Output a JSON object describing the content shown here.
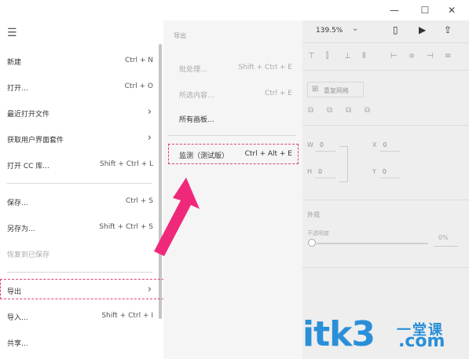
{
  "window": {
    "minimize": "—",
    "maximize": "☐",
    "close": "✕"
  },
  "menu": {
    "items": [
      {
        "label": "新建",
        "shortcut": "Ctrl + N"
      },
      {
        "label": "打开...",
        "shortcut": "Ctrl + O"
      },
      {
        "label": "最近打开文件",
        "shortcut": ""
      },
      {
        "label": "获取用户界面套件",
        "shortcut": ""
      },
      {
        "label": "打开 CC 库...",
        "shortcut": "Shift + Ctrl + L"
      },
      {
        "label": "保存...",
        "shortcut": "Ctrl + S"
      },
      {
        "label": "另存为...",
        "shortcut": "Shift + Ctrl + S"
      },
      {
        "label": "恢复到已保存",
        "shortcut": ""
      },
      {
        "label": "导出",
        "shortcut": ""
      },
      {
        "label": "导入...",
        "shortcut": "Shift + Ctrl + I"
      },
      {
        "label": "共享...",
        "shortcut": ""
      }
    ]
  },
  "submenu": {
    "title": "导出",
    "items": [
      {
        "label": "批处理...",
        "shortcut": "Shift + Ctrl + E"
      },
      {
        "label": "所选内容...",
        "shortcut": "Ctrl + E"
      },
      {
        "label": "所有画板...",
        "shortcut": ""
      },
      {
        "label": "监测（测试版）",
        "shortcut": "Ctrl + Alt + E"
      }
    ]
  },
  "properties": {
    "zoom": "139.5%",
    "repeat_grid": "重复网格",
    "w_label": "W",
    "w_value": "0",
    "x_label": "X",
    "x_value": "0",
    "h_label": "H",
    "h_value": "0",
    "y_label": "Y",
    "y_value": "0",
    "appearance": "外观",
    "opacity_label": "不透明度",
    "opacity_value": "0%"
  },
  "watermark": {
    "main": "itk3",
    "cn": "一堂课",
    "com": ".com"
  },
  "colors": {
    "accent_pink": "#f0287a",
    "watermark_blue": "#2a8fd8"
  },
  "icons": {
    "hamburger": "☰",
    "chevron": "›",
    "zoom_chevron": "⌄",
    "device": "▯",
    "play": "▶",
    "share": "⇪"
  }
}
